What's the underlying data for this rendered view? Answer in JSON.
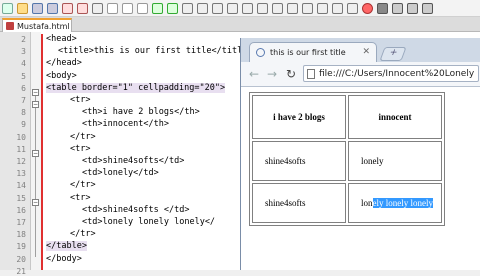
{
  "editor": {
    "tab_label": "Mustafa.html",
    "line_numbers": [
      "2",
      "3",
      "4",
      "5",
      "6",
      "7",
      "8",
      "9",
      "10",
      "11",
      "12",
      "13",
      "14",
      "15",
      "16",
      "17",
      "18",
      "19",
      "20",
      "21"
    ],
    "lines": [
      {
        "indent": 0,
        "text": "<head>"
      },
      {
        "indent": 1,
        "text": "<title>this is our first title</title>"
      },
      {
        "indent": 0,
        "text": "</head>"
      },
      {
        "indent": 0,
        "text": "<body>"
      },
      {
        "indent": 0,
        "text": "<table border=\"1\" cellpadding=\"20\">"
      },
      {
        "indent": 2,
        "text": "<tr>"
      },
      {
        "indent": 3,
        "text": "<th>i have 2 blogs</th>"
      },
      {
        "indent": 3,
        "text": "<th>innocent</th>"
      },
      {
        "indent": 2,
        "text": "</tr>"
      },
      {
        "indent": 2,
        "text": "<tr>"
      },
      {
        "indent": 3,
        "text": "<td>shine4softs</td>"
      },
      {
        "indent": 3,
        "text": "<td>lonely</td>"
      },
      {
        "indent": 2,
        "text": "</tr>"
      },
      {
        "indent": 2,
        "text": "<tr>"
      },
      {
        "indent": 3,
        "text": "<td>shine4softs </td>"
      },
      {
        "indent": 3,
        "text": "<td>lonely lonely lonely</"
      },
      {
        "indent": 2,
        "text": "</tr>"
      },
      {
        "indent": 0,
        "text": "</table>"
      },
      {
        "indent": 0,
        "text": "</body>"
      },
      {
        "indent": 0,
        "text": ""
      }
    ]
  },
  "browser": {
    "tab_title": "this is our first title",
    "close_glyph": "✕",
    "new_tab_glyph": "+",
    "url": "file:///C:/Users/Innocent%20Lonely",
    "nav": {
      "back": "←",
      "forward": "→",
      "reload": "↻"
    },
    "table": {
      "headers": [
        "i have 2 blogs",
        "innocent"
      ],
      "rows": [
        [
          "shine4softs",
          "lonely"
        ],
        [
          "shine4softs",
          "lonely lonely lonely"
        ]
      ],
      "selected_prefix": "lon",
      "selected_text": "ely lonely lonely"
    }
  }
}
